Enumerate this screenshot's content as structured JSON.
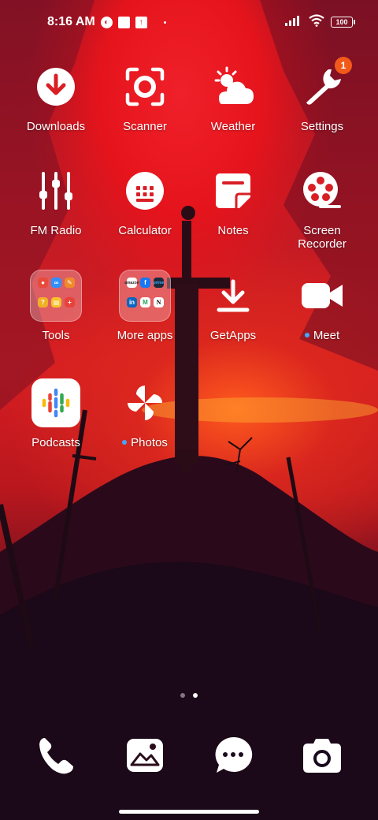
{
  "status_bar": {
    "time": "8:16 AM",
    "battery": "100",
    "icons": [
      "notification-c-icon",
      "notification-square-icon",
      "upload-icon",
      "signal-icon",
      "wifi-icon",
      "battery-icon"
    ]
  },
  "apps": {
    "downloads": {
      "label": "Downloads",
      "icon": "download-icon"
    },
    "scanner": {
      "label": "Scanner",
      "icon": "scanner-icon"
    },
    "weather": {
      "label": "Weather",
      "icon": "weather-icon"
    },
    "settings": {
      "label": "Settings",
      "icon": "wrench-icon",
      "badge": "1"
    },
    "fm_radio": {
      "label": "FM Radio",
      "icon": "equalizer-icon"
    },
    "calculator": {
      "label": "Calculator",
      "icon": "calculator-icon"
    },
    "notes": {
      "label": "Notes",
      "icon": "notes-icon"
    },
    "screen_recorder": {
      "label": "Screen\nRecorder",
      "icon": "film-reel-icon"
    },
    "tools": {
      "label": "Tools",
      "icon": "folder-icon"
    },
    "more_apps": {
      "label": "More apps",
      "icon": "folder-icon"
    },
    "getapps": {
      "label": "GetApps",
      "icon": "getapps-icon"
    },
    "meet": {
      "label": "Meet",
      "icon": "video-camera-icon",
      "new": true
    },
    "podcasts": {
      "label": "Podcasts",
      "icon": "podcasts-icon"
    },
    "photos": {
      "label": "Photos",
      "icon": "pinwheel-icon",
      "new": true
    }
  },
  "folders": {
    "more_apps_minis": [
      "amazon",
      "f",
      "prime",
      "in",
      "M",
      "N"
    ]
  },
  "pages": {
    "count": 2,
    "active": 2
  },
  "dock": {
    "phone": "phone-icon",
    "gallery": "gallery-icon",
    "messages": "messages-icon",
    "camera": "camera-icon"
  },
  "colors": {
    "badge": "#f25a1a",
    "new_dot": "#3fa8ff",
    "wallpaper_red": "#d61d22"
  }
}
